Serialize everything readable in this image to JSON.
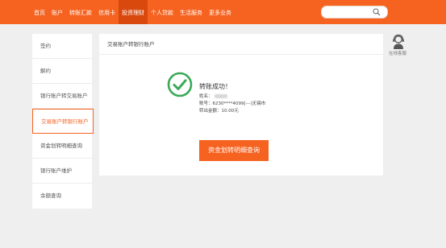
{
  "nav": {
    "items": [
      "首页",
      "账户",
      "转账汇款",
      "信用卡",
      "投资理财",
      "个人贷款",
      "生活服务",
      "更多业务"
    ],
    "active_index": 4
  },
  "search": {
    "placeholder": ""
  },
  "sidebar": {
    "items": [
      "签约",
      "解约",
      "银行账户转交易账户",
      "交易账户转银行账户",
      "资金划转明细查询",
      "银行账户维护",
      "余额查询"
    ],
    "active_index": 3
  },
  "main": {
    "header": "交易账户转银行账户",
    "result": {
      "title": "转账成功！",
      "name_label": "姓名：",
      "account_line": "账号：6230****4099[---]无锡市",
      "amount_line": "转出金额：10.00元"
    },
    "button_label": "资金划转明细查询"
  },
  "service": {
    "label": "在线客服"
  },
  "colors": {
    "brand": "#f6621f",
    "active_nav": "#d9480d",
    "success": "#3aa957"
  },
  "icons": {
    "search": "search-icon",
    "success": "check-circle-icon",
    "service": "customer-service-icon"
  }
}
